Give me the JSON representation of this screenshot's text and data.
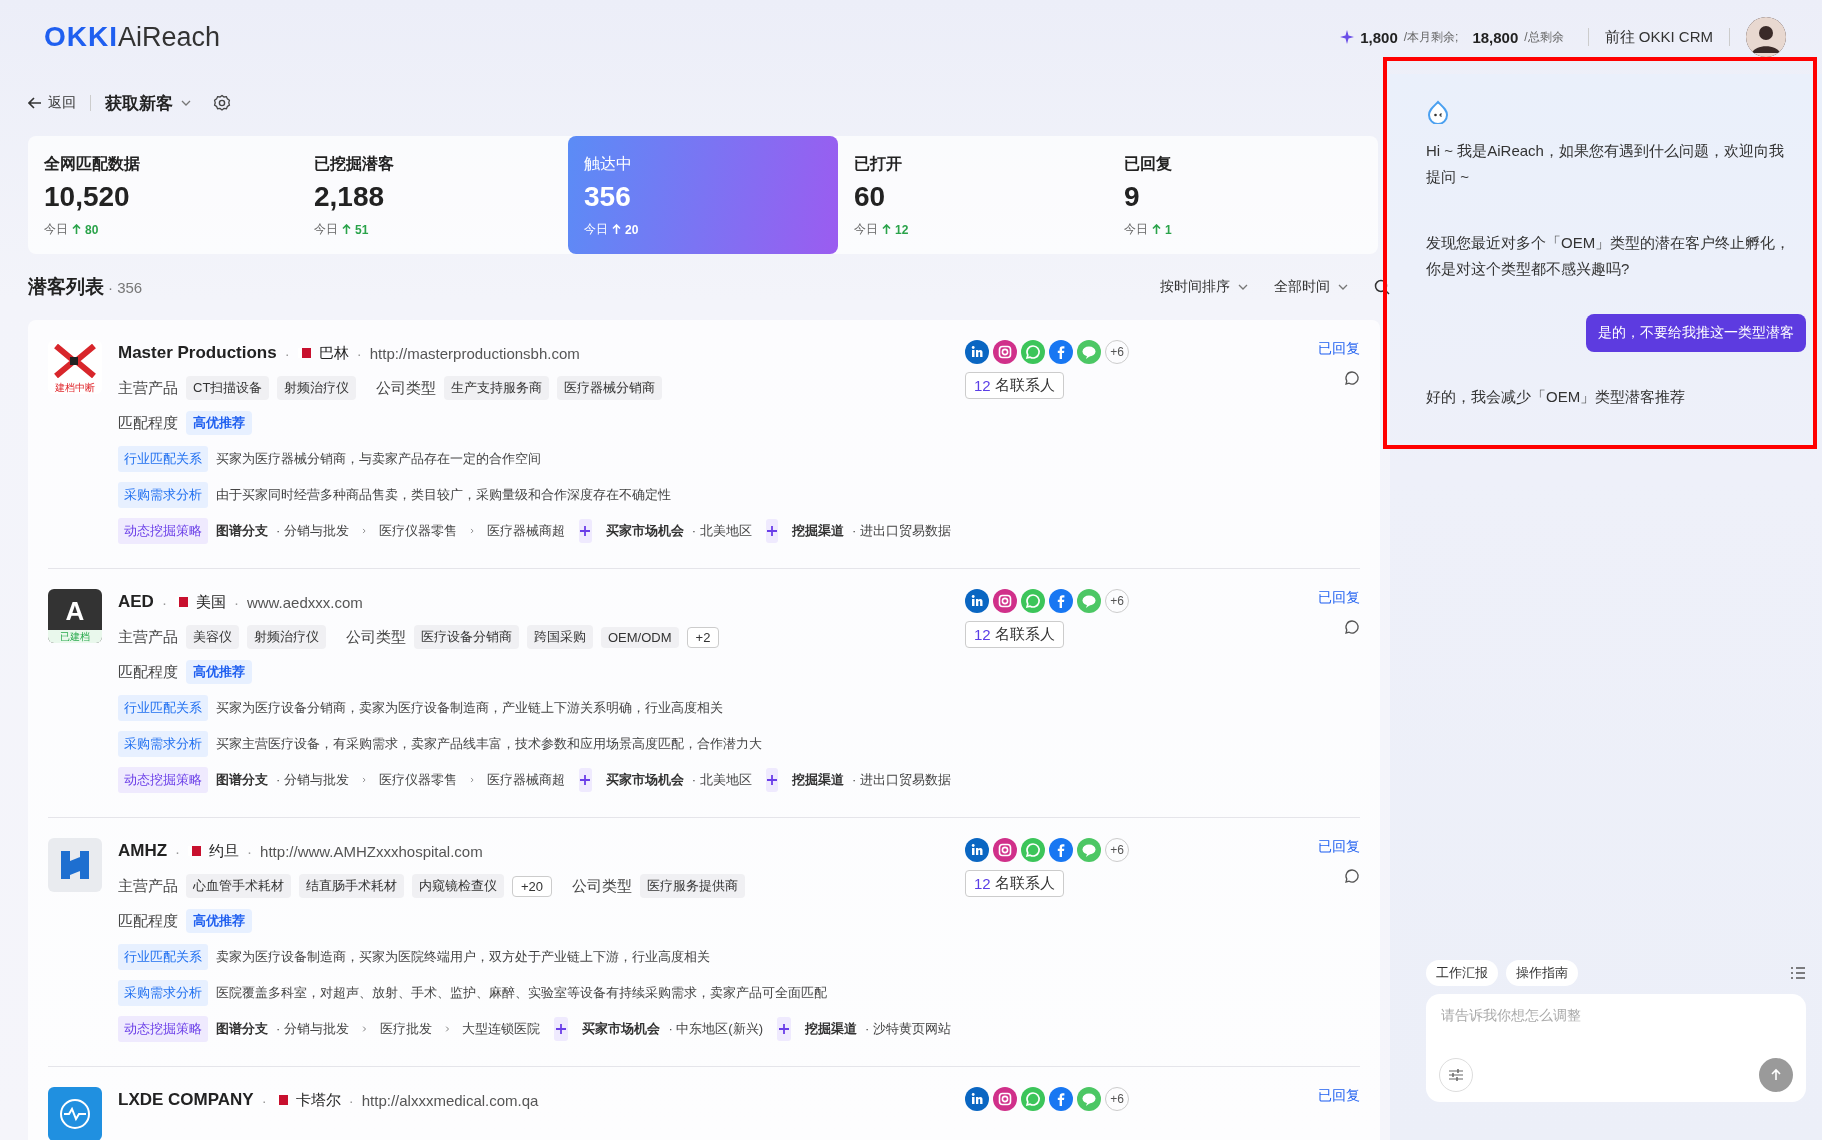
{
  "header": {
    "logo_brand": "OKKI",
    "logo_product": "AiReach",
    "credits": [
      {
        "value": "1,800",
        "unit": "/本月剩余;"
      },
      {
        "value": "18,800",
        "unit": "/总剩余"
      }
    ],
    "crm_link": "前往 OKKI CRM"
  },
  "toolbar": {
    "back": "返回",
    "title": "获取新客"
  },
  "stats": [
    {
      "label": "全网匹配数据",
      "value": "10,520",
      "today": "今日",
      "delta": "80",
      "selected": false
    },
    {
      "label": "已挖掘潜客",
      "value": "2,188",
      "today": "今日",
      "delta": "51",
      "selected": false
    },
    {
      "label": "触达中",
      "value": "356",
      "today": "今日",
      "delta": "20",
      "selected": true
    },
    {
      "label": "已打开",
      "value": "60",
      "today": "今日",
      "delta": "12",
      "selected": false
    },
    {
      "label": "已回复",
      "value": "9",
      "today": "今日",
      "delta": "1",
      "selected": false
    }
  ],
  "list": {
    "title": "潜客列表",
    "count": "· 356",
    "sort": "按时间排序",
    "range": "全部时间"
  },
  "leads": [
    {
      "logo": {
        "kind": "x-mark"
      },
      "badge": {
        "text": "建档中断",
        "kind": "interrupted"
      },
      "name": "Master Productions",
      "separators": [
        "·",
        "·"
      ],
      "country": "巴林",
      "url": "http://masterproductionsbh.com",
      "groups": [
        {
          "label": "主营产品",
          "tags": [
            "CT扫描设备",
            "射频治疗仪"
          ]
        },
        {
          "label": "公司类型",
          "tags": [
            "生产支持服务商",
            "医疗器械分销商"
          ]
        }
      ],
      "match_label": "匹配程度",
      "match": "高优推荐",
      "insights": [
        {
          "label": "行业匹配关系",
          "text": "买家为医疗器械分销商，与卖家产品存在一定的合作空间"
        },
        {
          "label": "采购需求分析",
          "text": "由于买家同时经营多种商品售卖，类目较广，采购量级和合作深度存在不确定性"
        }
      ],
      "strategy": {
        "label": "动态挖掘策略",
        "parts": [
          {
            "title": "图谱分支",
            "path": [
              "· 分销与批发",
              "医疗仪器零售",
              "医疗器械商超"
            ]
          },
          {
            "title": "买家市场机会",
            "path": [
              "· 北美地区"
            ]
          },
          {
            "title": "挖掘渠道",
            "path": [
              "· 进出口贸易数据"
            ]
          }
        ]
      },
      "socials_more": "+6",
      "contacts_count": "12",
      "contacts_label": "名联系人",
      "status": "已回复"
    },
    {
      "logo": {
        "kind": "letter",
        "text": "A"
      },
      "badge": {
        "text": "已建档",
        "kind": "filed"
      },
      "name": "AED",
      "separators": [
        "·",
        "·"
      ],
      "country": "美国",
      "url": "www.aedxxx.com",
      "groups": [
        {
          "label": "主营产品",
          "tags": [
            "美容仪",
            "射频治疗仪"
          ]
        },
        {
          "label": "公司类型",
          "tags": [
            "医疗设备分销商",
            "跨国采购",
            "OEM/ODM"
          ],
          "more": "+2"
        }
      ],
      "match_label": "匹配程度",
      "match": "高优推荐",
      "insights": [
        {
          "label": "行业匹配关系",
          "text": "买家为医疗设备分销商，卖家为医疗设备制造商，产业链上下游关系明确，行业高度相关"
        },
        {
          "label": "采购需求分析",
          "text": "买家主营医疗设备，有采购需求，卖家产品线丰富，技术参数和应用场景高度匹配，合作潜力大"
        }
      ],
      "strategy": {
        "label": "动态挖掘策略",
        "parts": [
          {
            "title": "图谱分支",
            "path": [
              "· 分销与批发",
              "医疗仪器零售",
              "医疗器械商超"
            ]
          },
          {
            "title": "买家市场机会",
            "path": [
              "· 北美地区"
            ]
          },
          {
            "title": "挖掘渠道",
            "path": [
              "· 进出口贸易数据"
            ]
          }
        ]
      },
      "socials_more": "+6",
      "contacts_count": "12",
      "contacts_label": "名联系人",
      "status": "已回复"
    },
    {
      "logo": {
        "kind": "h-mark"
      },
      "name": "AMHZ",
      "separators": [
        "·",
        "·"
      ],
      "country": "约旦",
      "url": "http://www.AMHZxxxhospital.com",
      "groups": [
        {
          "label": "主营产品",
          "tags": [
            "心血管手术耗材",
            "结直肠手术耗材",
            "内窥镜检查仪"
          ],
          "more": "+20"
        },
        {
          "label": "公司类型",
          "tags": [
            "医疗服务提供商"
          ]
        }
      ],
      "match_label": "匹配程度",
      "match": "高优推荐",
      "insights": [
        {
          "label": "行业匹配关系",
          "text": "卖家为医疗设备制造商，买家为医院终端用户，双方处于产业链上下游，行业高度相关"
        },
        {
          "label": "采购需求分析",
          "text": "医院覆盖多科室，对超声、放射、手术、监护、麻醉、实验室等设备有持续采购需求，卖家产品可全面匹配"
        }
      ],
      "strategy": {
        "label": "动态挖掘策略",
        "parts": [
          {
            "title": "图谱分支",
            "path": [
              "· 分销与批发",
              "医疗批发",
              "大型连锁医院"
            ]
          },
          {
            "title": "买家市场机会",
            "path": [
              "· 中东地区(新兴)"
            ]
          },
          {
            "title": "挖掘渠道",
            "path": [
              "· 沙特黄页网站"
            ]
          }
        ]
      },
      "socials_more": "+6",
      "contacts_count": "12",
      "contacts_label": "名联系人",
      "status": "已回复"
    },
    {
      "logo": {
        "kind": "wave"
      },
      "name": "LXDE COMPANY",
      "separators": [
        "·",
        "·"
      ],
      "country": "卡塔尔",
      "url": "http://alxxxmedical.com.qa",
      "socials_more": "+6",
      "status": "已回复"
    }
  ],
  "chat": {
    "messages": [
      {
        "kind": "bot",
        "text": "Hi ~ 我是AiReach，如果您有遇到什么问题，欢迎向我提问 ~"
      },
      {
        "kind": "bot",
        "text": "发现您最近对多个「OEM」类型的潜在客户终止孵化，你是对这个类型都不感兴趣吗?"
      },
      {
        "kind": "user",
        "text": "是的，不要给我推这一类型潜客"
      },
      {
        "kind": "bot",
        "text": "好的，我会减少「OEM」类型潜客推荐"
      }
    ],
    "chips": [
      "工作汇报",
      "操作指南"
    ],
    "placeholder": "请告诉我你想怎么调整"
  }
}
